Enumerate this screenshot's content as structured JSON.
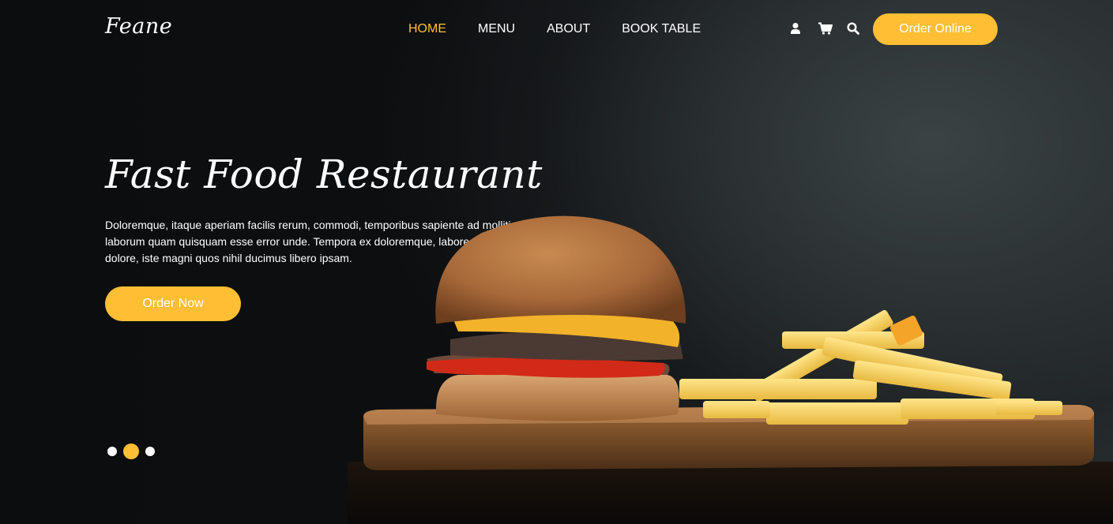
{
  "header": {
    "logo": "Feane",
    "nav": [
      {
        "label": "HOME",
        "active": true
      },
      {
        "label": "MENU",
        "active": false
      },
      {
        "label": "ABOUT",
        "active": false
      },
      {
        "label": "BOOK TABLE",
        "active": false
      }
    ],
    "icons": [
      "user-icon",
      "cart-icon",
      "search-icon"
    ],
    "order_online_label": "Order Online"
  },
  "hero": {
    "title": "Fast Food Restaurant",
    "description": "Doloremque, itaque aperiam facilis rerum, commodi, temporibus sapiente ad mollitia laborum quam quisquam esse error unde. Tempora ex doloremque, labore, sunt repellat dolore, iste magni quos nihil ducimus libero ipsam.",
    "order_now_label": "Order Now",
    "image": "burger-and-fries",
    "carousel": {
      "total": 3,
      "active_index": 1
    }
  },
  "colors": {
    "accent": "#ffbe33",
    "background": "#0c0d0f",
    "text": "#ffffff"
  }
}
